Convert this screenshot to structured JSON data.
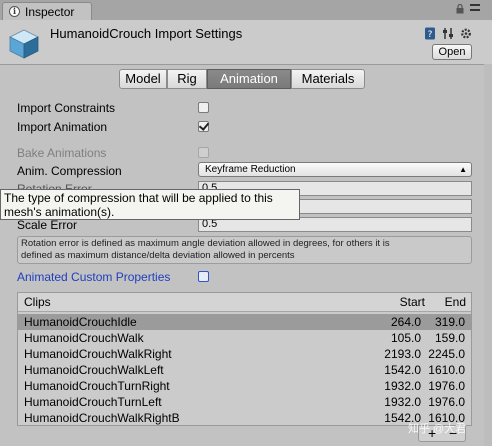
{
  "window": {
    "tab_title": "Inspector"
  },
  "header": {
    "title": "HumanoidCrouch Import Settings",
    "open_label": "Open"
  },
  "tabs": [
    {
      "label": "Model",
      "active": false
    },
    {
      "label": "Rig",
      "active": false
    },
    {
      "label": "Animation",
      "active": true
    },
    {
      "label": "Materials",
      "active": false
    }
  ],
  "settings": {
    "import_constraints": {
      "label": "Import Constraints",
      "checked": false
    },
    "import_animation": {
      "label": "Import Animation",
      "checked": true
    },
    "bake_animations": {
      "label": "Bake Animations",
      "checked": false,
      "disabled": true
    },
    "anim_compression": {
      "label": "Anim. Compression",
      "value": "Keyframe Reduction"
    },
    "rotation_error": {
      "label": "Rotation Error",
      "value": "0.5"
    },
    "position_error": {
      "value": "0.5"
    },
    "scale_error": {
      "label": "Scale Error",
      "value": "0.5"
    },
    "tooltip": "The type of compression that will be applied to this mesh's animation(s).",
    "help_line1": "Rotation error is defined as maximum angle deviation allowed in degrees, for others it is",
    "help_line2": "defined as maximum distance/delta deviation allowed in percents",
    "animated_custom_properties": {
      "label": "Animated Custom Properties",
      "checked": false
    }
  },
  "clips": {
    "headers": {
      "name": "Clips",
      "start": "Start",
      "end": "End"
    },
    "rows": [
      {
        "name": "HumanoidCrouchIdle",
        "start": "264.0",
        "end": "319.0",
        "selected": true
      },
      {
        "name": "HumanoidCrouchWalk",
        "start": "105.0",
        "end": "159.0",
        "selected": false
      },
      {
        "name": "HumanoidCrouchWalkRight",
        "start": "2193.0",
        "end": "2245.0",
        "selected": false
      },
      {
        "name": "HumanoidCrouchWalkLeft",
        "start": "1542.0",
        "end": "1610.0",
        "selected": false
      },
      {
        "name": "HumanoidCrouchTurnRight",
        "start": "1932.0",
        "end": "1976.0",
        "selected": false
      },
      {
        "name": "HumanoidCrouchTurnLeft",
        "start": "1932.0",
        "end": "1976.0",
        "selected": false
      },
      {
        "name": "HumanoidCrouchWalkRightB",
        "start": "1542.0",
        "end": "1610.0",
        "selected": false
      }
    ],
    "add_label": "+",
    "remove_label": "−"
  },
  "watermark": "知乎 @大君"
}
